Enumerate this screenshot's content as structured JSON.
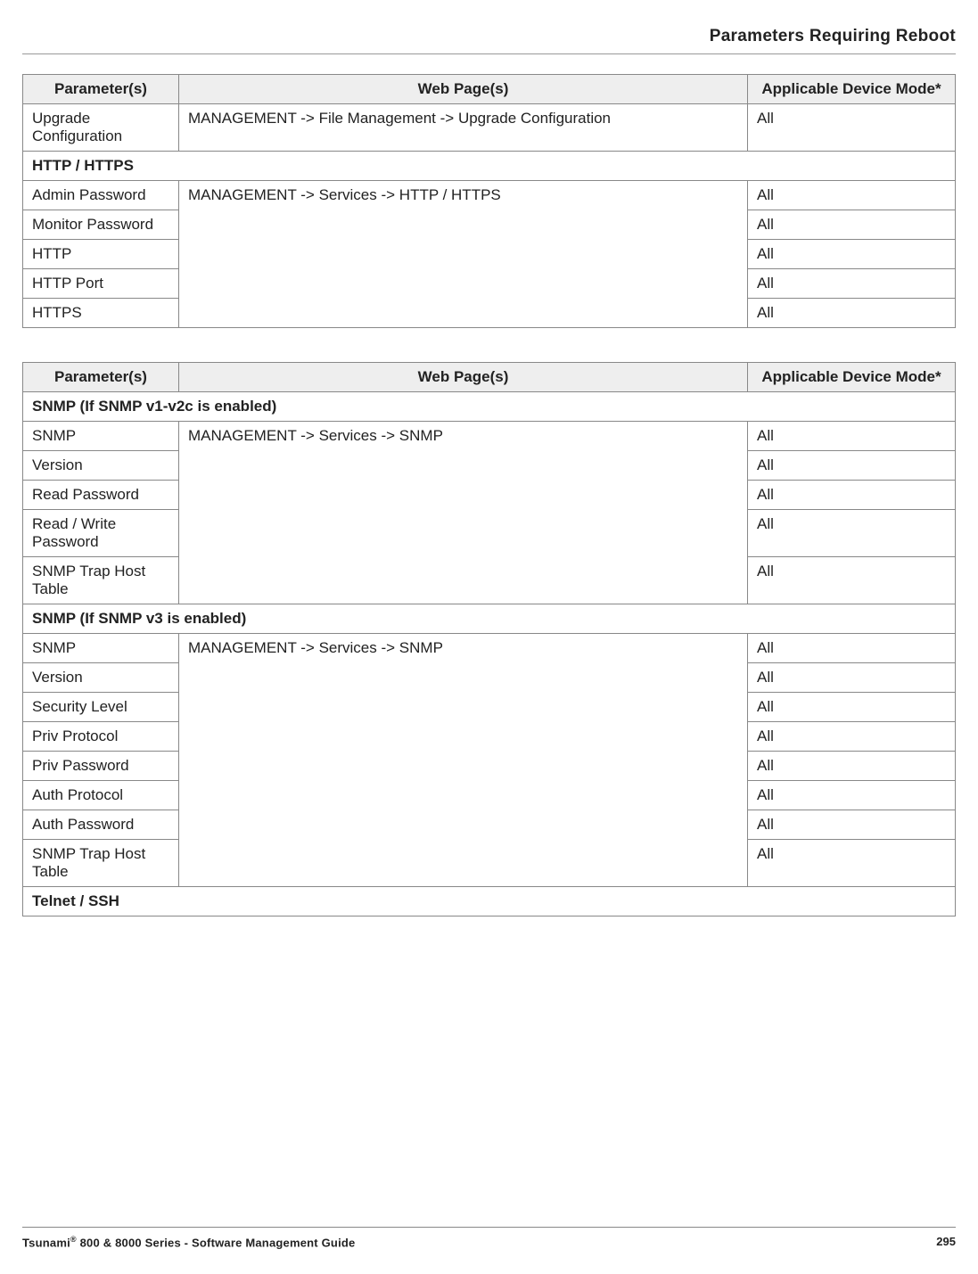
{
  "header": {
    "title": "Parameters Requiring Reboot"
  },
  "table1": {
    "headers": {
      "col1": "Parameter(s)",
      "col2": "Web Page(s)",
      "col3": "Applicable Device Mode*"
    },
    "row_upgrade": {
      "param": "Upgrade Configuration",
      "page": "MANAGEMENT -> File Management -> Upgrade Configuration",
      "mode": "All"
    },
    "section_http": "HTTP / HTTPS",
    "http_page": "MANAGEMENT -> Services -> HTTP / HTTPS",
    "http_rows": {
      "r1": {
        "param": "Admin Password",
        "mode": "All"
      },
      "r2": {
        "param": "Monitor Password",
        "mode": "All"
      },
      "r3": {
        "param": "HTTP",
        "mode": "All"
      },
      "r4": {
        "param": "HTTP Port",
        "mode": "All"
      },
      "r5": {
        "param": "HTTPS",
        "mode": "All"
      }
    }
  },
  "table2": {
    "headers": {
      "col1": "Parameter(s)",
      "col2": "Web Page(s)",
      "col3": "Applicable Device Mode*"
    },
    "section_snmp_v12": "SNMP (If SNMP v1-v2c is enabled)",
    "snmp_page": "MANAGEMENT -> Services -> SNMP",
    "snmp_v12_rows": {
      "r1": {
        "param": "SNMP",
        "mode": "All"
      },
      "r2": {
        "param": "Version",
        "mode": "All"
      },
      "r3": {
        "param": "Read Password",
        "mode": "All"
      },
      "r4": {
        "param": "Read / Write Password",
        "mode": "All"
      },
      "r5": {
        "param": "SNMP Trap Host Table",
        "mode": "All"
      }
    },
    "section_snmp_v3": "SNMP (If SNMP v3 is enabled)",
    "snmp_v3_rows": {
      "r1": {
        "param": "SNMP",
        "mode": "All"
      },
      "r2": {
        "param": "Version",
        "mode": "All"
      },
      "r3": {
        "param": "Security Level",
        "mode": "All"
      },
      "r4": {
        "param": "Priv Protocol",
        "mode": "All"
      },
      "r5": {
        "param": "Priv Password",
        "mode": "All"
      },
      "r6": {
        "param": "Auth Protocol",
        "mode": "All"
      },
      "r7": {
        "param": "Auth Password",
        "mode": "All"
      },
      "r8": {
        "param": "SNMP Trap Host Table",
        "mode": "All"
      }
    },
    "section_telnet": "Telnet / SSH"
  },
  "footer": {
    "left_prefix": "Tsunami",
    "left_suffix": " 800 & 8000 Series - Software Management Guide",
    "page_number": "295"
  }
}
